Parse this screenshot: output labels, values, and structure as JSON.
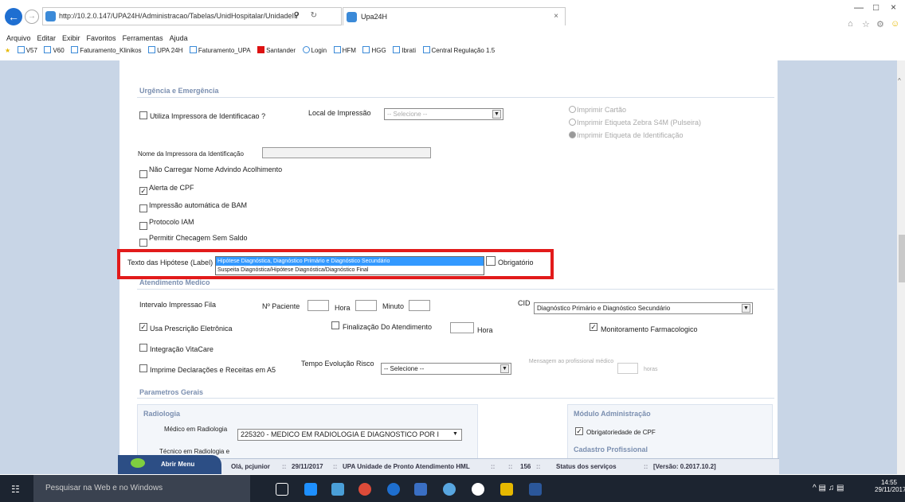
{
  "browser": {
    "url": "http://10.2.0.147/UPA24H/Administracao/Tabelas/UnidHospitalar/UnidadeII/Parametr",
    "tab_title": "Upa24H",
    "menu": [
      "Arquivo",
      "Editar",
      "Exibir",
      "Favoritos",
      "Ferramentas",
      "Ajuda"
    ],
    "favorites": [
      "V57",
      "V60",
      "Faturamento_Klinikos",
      "UPA 24H",
      "Faturamento_UPA",
      "Santander",
      "Login",
      "HFM",
      "HGG",
      "Ibrati",
      "Central Regulação 1.5"
    ]
  },
  "urgencia": {
    "title": "Urgência e Emergência",
    "utiliza_impressora": "Utiliza Impressora de Identificacao ?",
    "local_impressao": "Local de Impressão",
    "local_impressao_value": "-- Selecione --",
    "imprimir_cartao": "Imprimir Cartão",
    "imprimir_etiqueta_zebra": "Imprimir Etiqueta Zebra S4M (Pulseira)",
    "imprimir_etiqueta_id": "Imprimir Etiqueta de Identificação",
    "nome_impressora": "Nome da Impressora da Identificação",
    "nao_carregar": "Não Carregar Nome Advindo Acolhimento",
    "alerta_cpf": "Alerta de CPF",
    "impressao_bam": "Impressão automática de BAM",
    "protocolo_iam": "Protocolo IAM",
    "permitir_checagem": "Permitir Checagem Sem Saldo",
    "texto_hipotese": "Texto das Hipótese (Label)",
    "hipotese_opt1": "Hipótese Diagnóstica, Diagnóstico Primário e Diagnóstico Secundário",
    "hipotese_opt2": "Suspeita Diagnóstica/Hipótese Diagnóstica/Diagnóstico Final",
    "obrigatorio": "Obrigatório"
  },
  "atendimento": {
    "title": "Atendimento Medico",
    "intervalo": "Intervalo Impressao Fila",
    "n_paciente": "Nº Paciente",
    "hora": "Hora",
    "minuto": "Minuto",
    "cid": "CID",
    "cid_value": "Diagnóstico Primário e Diagnóstico Secundário",
    "usa_prescricao": "Usa Prescrição Eletrônica",
    "finalizacao": "Finalização Do Atendimento",
    "hora2": "Hora",
    "monitoramento": "Monitoramento Farmacologico",
    "integracao": "Integração VitaCare",
    "imprime_declaracoes": "Imprime Declarações e Receitas em A5",
    "tempo_evolucao": "Tempo Evolução Risco",
    "tempo_evolucao_value": "-- Selecione --",
    "mensagem_prof": "Mensagem ao profissional médico",
    "horas": "horas"
  },
  "gerais": {
    "title": "Parametros Gerais",
    "radiologia": "Radiologia",
    "medico_radiologia": "Médico em Radiologia",
    "medico_radiologia_value": "225320 - MEDICO EM RADIOLOGIA E DIAGNOSTICO POR I",
    "tecnico_radiologia": "Técnico em Radiologia e",
    "modulo_admin": "Módulo Administração",
    "obrigatoriedade_cpf": "Obrigatoriedade de CPF",
    "cadastro_profissional": "Cadastro Profissional"
  },
  "status": {
    "menu_btn": "Abrir Menu",
    "user": "Olá, pcjunior",
    "date": "29/11/2017",
    "unit": "UPA Unidade de Pronto Atendimento HML",
    "count": "156",
    "servicos": "Status dos serviços",
    "version": "[Versão: 0.2017.10.2]"
  },
  "taskbar": {
    "search": "Pesquisar na Web e no Windows",
    "time": "14:55",
    "date": "29/11/2017"
  }
}
